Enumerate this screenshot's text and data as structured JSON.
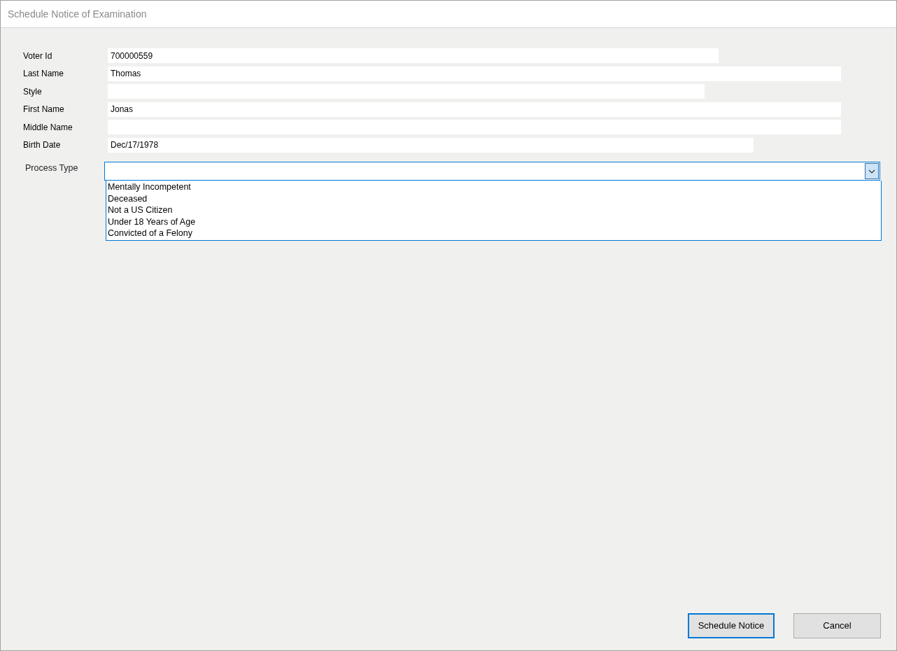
{
  "window": {
    "title": "Schedule Notice of Examination"
  },
  "fields": [
    {
      "label": "Voter Id",
      "value": "700000559"
    },
    {
      "label": "Last Name",
      "value": "Thomas"
    },
    {
      "label": "Style"
    },
    {
      "label": "First Name",
      "value": "Jonas"
    },
    {
      "label": "Middle Name"
    },
    {
      "label": "Birth Date",
      "value": "Dec/17/1978"
    }
  ],
  "process_type": {
    "label": "Process Type",
    "expanded": true,
    "options": [
      "Mentally Incompetent",
      "Deceased",
      "Not a US Citizen",
      "Under 18 Years of Age",
      "Convicted of a Felony"
    ]
  },
  "buttons": [
    {
      "label": "Schedule Notice",
      "default": true
    },
    {
      "label": "Cancel",
      "default": false
    }
  ]
}
